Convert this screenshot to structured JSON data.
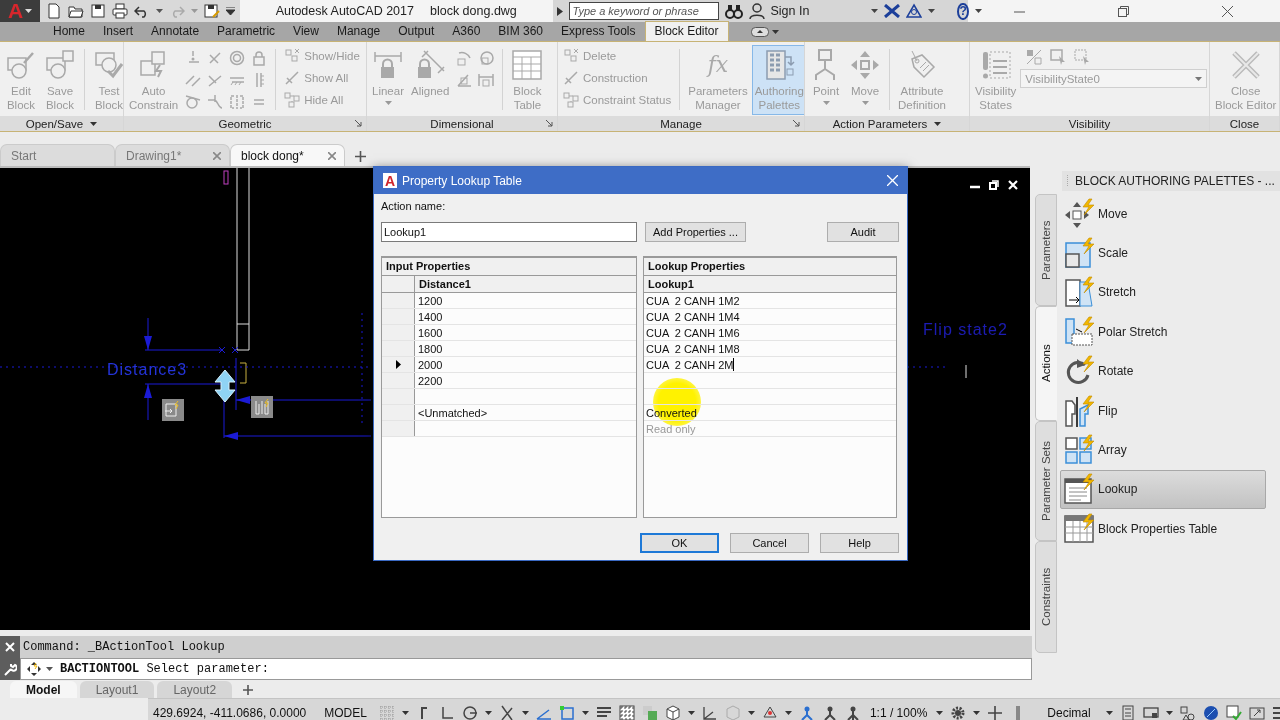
{
  "title_bar": {
    "logo": "A",
    "app_title": "Autodesk AutoCAD 2017",
    "file_name": "block dong.dwg",
    "search": {
      "placeholder": "Type a keyword or phrase"
    },
    "sign_in": "Sign In",
    "help": "?"
  },
  "ribbon": {
    "tabs": [
      {
        "label": "Home",
        "selected": false
      },
      {
        "label": "Insert",
        "selected": false
      },
      {
        "label": "Annotate",
        "selected": false
      },
      {
        "label": "Parametric",
        "selected": false
      },
      {
        "label": "View",
        "selected": false
      },
      {
        "label": "Manage",
        "selected": false
      },
      {
        "label": "Output",
        "selected": false
      },
      {
        "label": "A360",
        "selected": false
      },
      {
        "label": "BIM 360",
        "selected": false
      },
      {
        "label": "Express Tools",
        "selected": false
      },
      {
        "label": "Block Editor",
        "selected": true
      }
    ],
    "panels": [
      {
        "title": "Open/Save",
        "menu": true,
        "launcher": false,
        "items": [
          {
            "kind": "large",
            "label": "Edit\nBlock",
            "disabled": true,
            "on": false,
            "has_menu": false
          },
          {
            "kind": "large",
            "label": "Save\nBlock",
            "disabled": true,
            "on": false,
            "has_menu": false
          },
          {
            "kind": "separator"
          },
          {
            "kind": "large",
            "label": "Test\nBlock",
            "disabled": true,
            "on": false,
            "has_menu": false
          }
        ]
      },
      {
        "title": "Geometric",
        "menu": false,
        "launcher": true,
        "items": [
          {
            "kind": "large",
            "label": "Auto\nConstrain",
            "disabled": true,
            "on": false,
            "has_menu": false
          },
          {
            "kind": "icon-grid"
          },
          {
            "kind": "separator"
          },
          {
            "kind": "small",
            "label": "Show/Hide",
            "disabled": true
          },
          {
            "kind": "small",
            "label": "Show All",
            "disabled": true
          },
          {
            "kind": "small",
            "label": "Hide All",
            "disabled": true
          }
        ]
      },
      {
        "title": "Dimensional",
        "menu": false,
        "launcher": true,
        "items": [
          {
            "kind": "large",
            "label": "Linear",
            "disabled": true,
            "on": false,
            "has_menu": true
          },
          {
            "kind": "large",
            "label": "Aligned",
            "disabled": true,
            "on": false,
            "has_menu": false
          },
          {
            "kind": "icon-grid"
          },
          {
            "kind": "separator"
          },
          {
            "kind": "large",
            "label": "Block\nTable",
            "disabled": true,
            "on": false,
            "has_menu": false
          }
        ]
      },
      {
        "title": "Manage",
        "menu": false,
        "launcher": true,
        "items": [
          {
            "kind": "small",
            "label": "Delete",
            "disabled": true
          },
          {
            "kind": "small",
            "label": "Construction",
            "disabled": true
          },
          {
            "kind": "small",
            "label": "Constraint Status",
            "disabled": true
          },
          {
            "kind": "separator"
          },
          {
            "kind": "large",
            "label": "Parameters\nManager",
            "glyph": "fx",
            "disabled": true,
            "on": false,
            "has_menu": false
          },
          {
            "kind": "large",
            "label": "Authoring\nPalettes",
            "disabled": true,
            "on": true,
            "has_menu": false
          }
        ]
      },
      {
        "title": "Action Parameters",
        "menu": true,
        "launcher": false,
        "items": [
          {
            "kind": "large",
            "label": "Point",
            "disabled": true,
            "on": false,
            "has_menu": true
          },
          {
            "kind": "large",
            "label": "Move",
            "disabled": true,
            "on": false,
            "has_menu": true
          },
          {
            "kind": "separator"
          },
          {
            "kind": "large",
            "label": "Attribute\nDefinition",
            "disabled": true,
            "on": false,
            "has_menu": false
          }
        ]
      },
      {
        "title": "Visibility",
        "menu": false,
        "launcher": false,
        "items": [
          {
            "kind": "large",
            "label": "Visibility\nStates",
            "disabled": true,
            "on": false,
            "has_menu": false
          },
          {
            "kind": "dropdown-group",
            "value": "VisibilityState0",
            "disabled": true
          }
        ]
      },
      {
        "title": "Close",
        "menu": false,
        "launcher": false,
        "items": [
          {
            "kind": "large",
            "label": "Close\nBlock Editor",
            "disabled": true,
            "on": false,
            "has_menu": false
          }
        ]
      }
    ]
  },
  "document_tabs": [
    {
      "label": "Start",
      "selected": false,
      "closable": false
    },
    {
      "label": "Drawing1*",
      "selected": false,
      "closable": true
    },
    {
      "label": "block dong*",
      "selected": true,
      "closable": true
    }
  ],
  "canvas": {
    "labels": [
      "Distance3",
      "Flip state2"
    ]
  },
  "dialog": {
    "icon_letter": "A",
    "title": "Property Lookup Table",
    "action_name_label": "Action name:",
    "action_name": "Lookup1",
    "top_buttons": [
      "Add Properties ...",
      "Audit"
    ],
    "input_group": "Input Properties",
    "input_column": "Distance1",
    "lookup_group": "Lookup Properties",
    "lookup_column": "Lookup1",
    "rows": [
      {
        "input": "1200",
        "lookup": "CUA  2 CANH 1M2",
        "current": false,
        "editing": false,
        "greyed": false
      },
      {
        "input": "1400",
        "lookup": "CUA  2 CANH 1M4",
        "current": false,
        "editing": false,
        "greyed": false
      },
      {
        "input": "1600",
        "lookup": "CUA  2 CANH 1M6",
        "current": false,
        "editing": false,
        "greyed": false
      },
      {
        "input": "1800",
        "lookup": "CUA  2 CANH 1M8",
        "current": false,
        "editing": false,
        "greyed": false
      },
      {
        "input": "2000",
        "lookup": "CUA  2 CANH 2M",
        "current": true,
        "editing": true,
        "greyed": false
      },
      {
        "input": "2200",
        "current": false
      },
      {
        "current": false
      },
      {
        "input": "<Unmatched>",
        "lookup": "Converted",
        "current": false,
        "editing": false,
        "greyed": false
      },
      {
        "lookup": "Read only",
        "current": false,
        "editing": false,
        "greyed": true
      }
    ],
    "buttons": [
      {
        "label": "OK",
        "default": true
      },
      {
        "label": "Cancel",
        "default": false
      },
      {
        "label": "Help",
        "default": false
      }
    ]
  },
  "palette": {
    "title": "BLOCK AUTHORING PALETTES - ...",
    "tabs": [
      {
        "label": "Parameters",
        "selected": false
      },
      {
        "label": "Actions",
        "selected": true
      },
      {
        "label": "Parameter Sets",
        "selected": false
      },
      {
        "label": "Constraints",
        "selected": false
      }
    ],
    "items": [
      {
        "label": "Move",
        "selected": false
      },
      {
        "label": "Scale",
        "selected": false
      },
      {
        "label": "Stretch",
        "selected": false
      },
      {
        "label": "Polar Stretch",
        "selected": false
      },
      {
        "label": "Rotate",
        "selected": false
      },
      {
        "label": "Flip",
        "selected": false
      },
      {
        "label": "Array",
        "selected": false
      },
      {
        "label": "Lookup",
        "selected": true
      },
      {
        "label": "Block Properties Table",
        "selected": false
      }
    ]
  },
  "command": {
    "history": "Command: _BActionTool Lookup",
    "prompt": "**BACTIONTOOL** Select parameter:"
  },
  "layout_tabs": [
    {
      "label": "Model",
      "selected": true
    },
    {
      "label": "Layout1",
      "selected": false
    },
    {
      "label": "Layout2",
      "selected": false
    }
  ],
  "status_bar": {
    "coordinates": "429.6924, -411.0686, 0.0000",
    "space": "MODEL",
    "scale": "1:1 / 100%",
    "units": "Decimal"
  }
}
